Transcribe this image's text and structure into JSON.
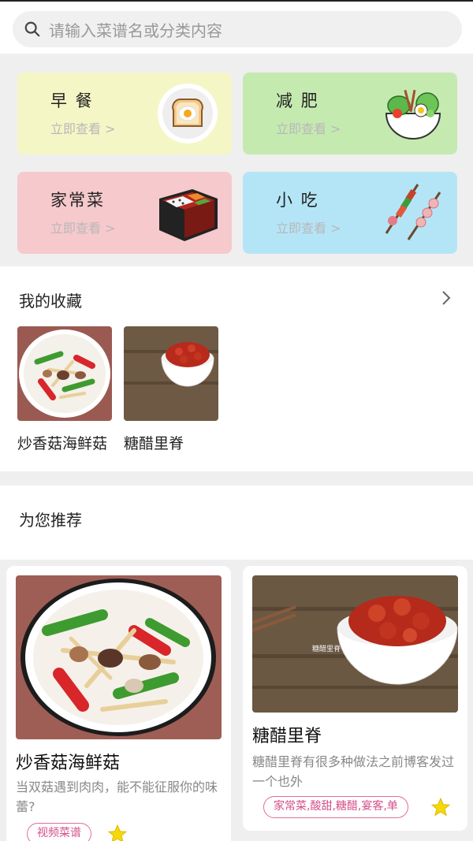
{
  "search": {
    "placeholder": "请输入菜谱名或分类内容",
    "icon": "search-icon"
  },
  "categories": [
    {
      "name": "早 餐",
      "action": "立即查看 >",
      "bg": "#f5f6c6",
      "icon": "toast-egg-icon"
    },
    {
      "name": "减 肥",
      "action": "立即查看 >",
      "bg": "#c5eab0",
      "icon": "salad-bowl-icon"
    },
    {
      "name": "家常菜",
      "action": "立即查看 >",
      "bg": "#f6c9cd",
      "icon": "bento-box-icon"
    },
    {
      "name": "小 吃",
      "action": "立即查看 >",
      "bg": "#b4e5f7",
      "icon": "skewer-icon"
    }
  ],
  "favorites": {
    "title": "我的收藏",
    "items": [
      {
        "name": "炒香菇海鲜菇"
      },
      {
        "name": "糖醋里脊"
      }
    ]
  },
  "recommend": {
    "title": "为您推荐",
    "cards": [
      {
        "title": "炒香菇海鲜菇",
        "desc": "当双菇遇到肉肉，能不能征服你的味蕾?",
        "tag": "视频菜谱"
      },
      {
        "title": "糖醋里脊",
        "desc": "糖醋里脊有很多种做法之前博客发过一个也外",
        "tag": "家常菜,酸甜,糖醋,宴客,单"
      }
    ]
  },
  "colors": {
    "accent": "#d44f8a",
    "star": "#f5d90a"
  }
}
